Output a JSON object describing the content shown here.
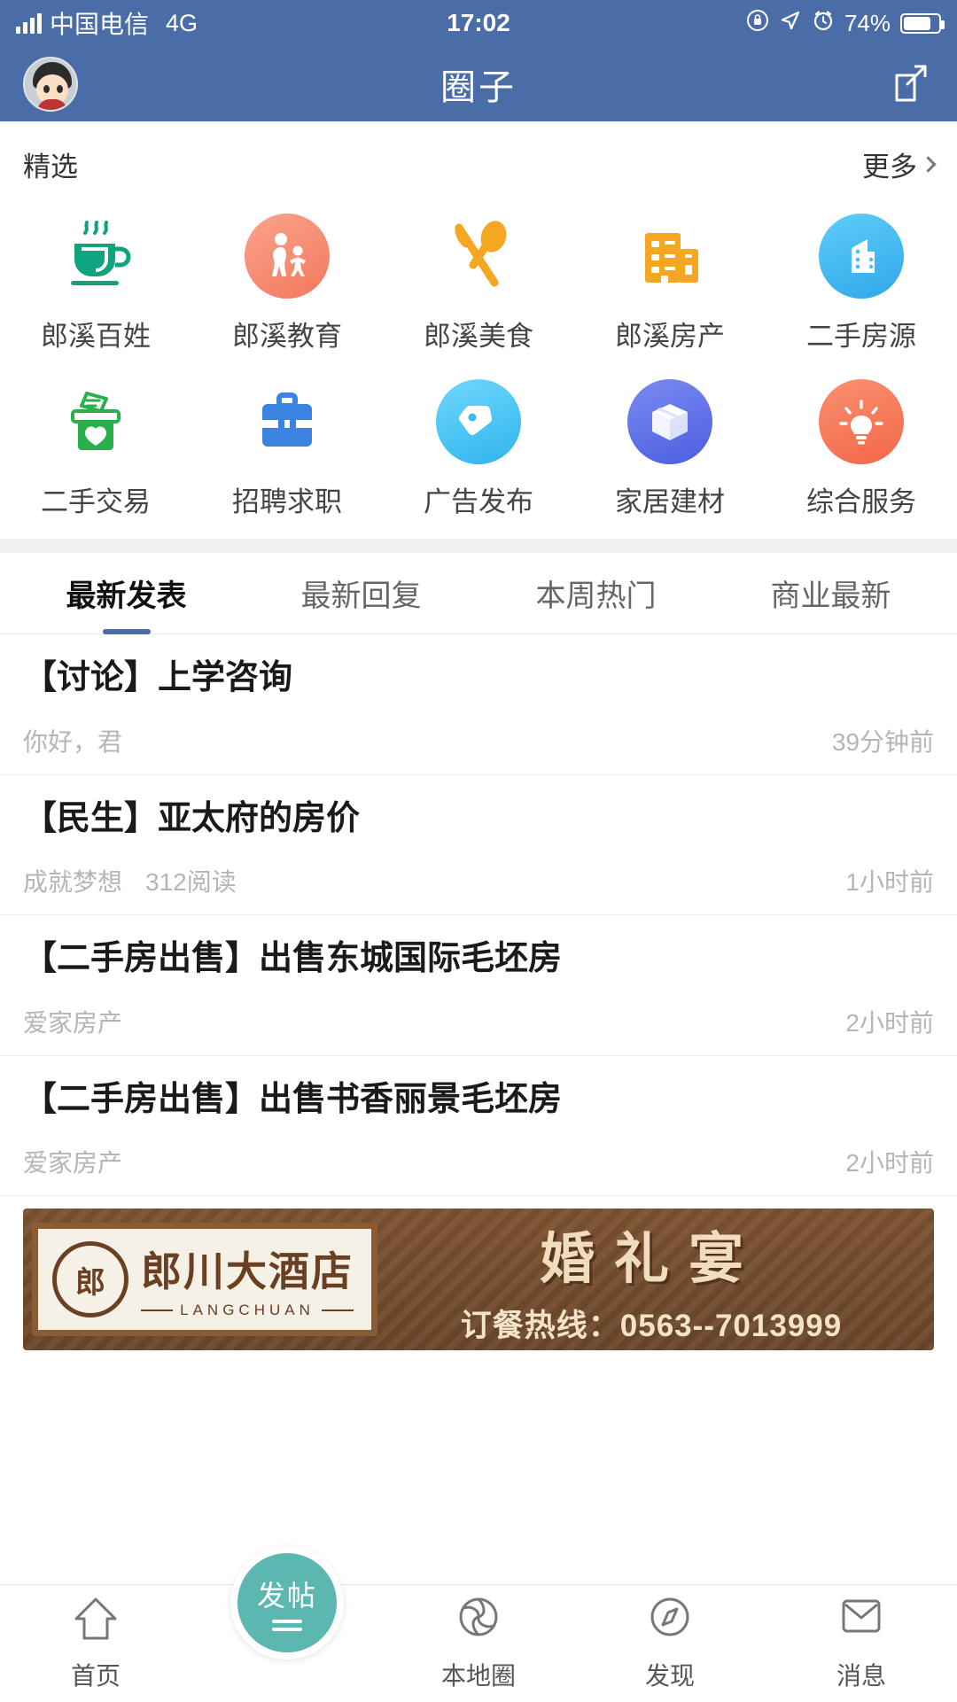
{
  "status_bar": {
    "carrier": "中国电信",
    "network": "4G",
    "time": "17:02",
    "battery_percent": "74%",
    "icons": [
      "signal-icon",
      "lock-rotation-icon",
      "location-arrow-icon",
      "alarm-clock-icon",
      "battery-icon"
    ]
  },
  "header": {
    "title": "圈子",
    "avatar_name": "user-avatar",
    "compose_icon": "compose-edit-icon"
  },
  "featured": {
    "section_title": "精选",
    "more_label": "更多",
    "items": [
      {
        "label": "郎溪百姓",
        "icon": "coffee-cup-icon",
        "style": "plain",
        "color": "#0fa47f"
      },
      {
        "label": "郎溪教育",
        "icon": "parent-child-icon",
        "style": "circle",
        "color": "#f58f73"
      },
      {
        "label": "郎溪美食",
        "icon": "fork-spoon-icon",
        "style": "plain",
        "color": "#f5a623"
      },
      {
        "label": "郎溪房产",
        "icon": "office-building-icon",
        "style": "plain",
        "color": "#f5a623"
      },
      {
        "label": "二手房源",
        "icon": "building-circle-icon",
        "style": "circle",
        "color": "#43b8f0"
      },
      {
        "label": "二手交易",
        "icon": "money-box-icon",
        "style": "plain",
        "color": "#2ab04b"
      },
      {
        "label": "招聘求职",
        "icon": "briefcase-icon",
        "style": "plain",
        "color": "#3a83e0"
      },
      {
        "label": "广告发布",
        "icon": "price-tag-icon",
        "style": "circle",
        "color": "#42c0f5"
      },
      {
        "label": "家居建材",
        "icon": "package-box-icon",
        "style": "circle",
        "color": "#5b6ee8"
      },
      {
        "label": "综合服务",
        "icon": "lightbulb-icon",
        "style": "circle",
        "color": "#f4795c"
      }
    ]
  },
  "tabs": [
    {
      "label": "最新发表",
      "active": true
    },
    {
      "label": "最新回复",
      "active": false
    },
    {
      "label": "本周热门",
      "active": false
    },
    {
      "label": "商业最新",
      "active": false
    }
  ],
  "posts": [
    {
      "title": "【讨论】上学咨询",
      "author": "你好，君",
      "reads": "",
      "time": "39分钟前"
    },
    {
      "title": "【民生】亚太府的房价",
      "author": "成就梦想",
      "reads": "312阅读",
      "time": "1小时前"
    },
    {
      "title": "【二手房出售】出售东城国际毛坯房",
      "author": "爱家房产",
      "reads": "",
      "time": "2小时前"
    },
    {
      "title": "【二手房出售】出售书香丽景毛坯房",
      "author": "爱家房产",
      "reads": "",
      "time": "2小时前"
    }
  ],
  "banner": {
    "seal_text": "郎",
    "hotel_name": "郎川大酒店",
    "hotel_pinyin": "LANGCHUAN",
    "headline": "婚礼宴",
    "hotline": "订餐热线：0563--7013999"
  },
  "bottom_nav": {
    "post_button": {
      "label": "发帖",
      "icon": "post-compose-icon",
      "color": "#5bb7b0"
    },
    "items": [
      {
        "label": "首页",
        "icon": "home-arrow-icon",
        "active": false
      },
      {
        "label": "本地圈",
        "icon": "aperture-circle-icon",
        "active": false
      },
      {
        "label": "发现",
        "icon": "compass-icon",
        "active": false
      },
      {
        "label": "消息",
        "icon": "envelope-icon",
        "active": false
      }
    ]
  }
}
